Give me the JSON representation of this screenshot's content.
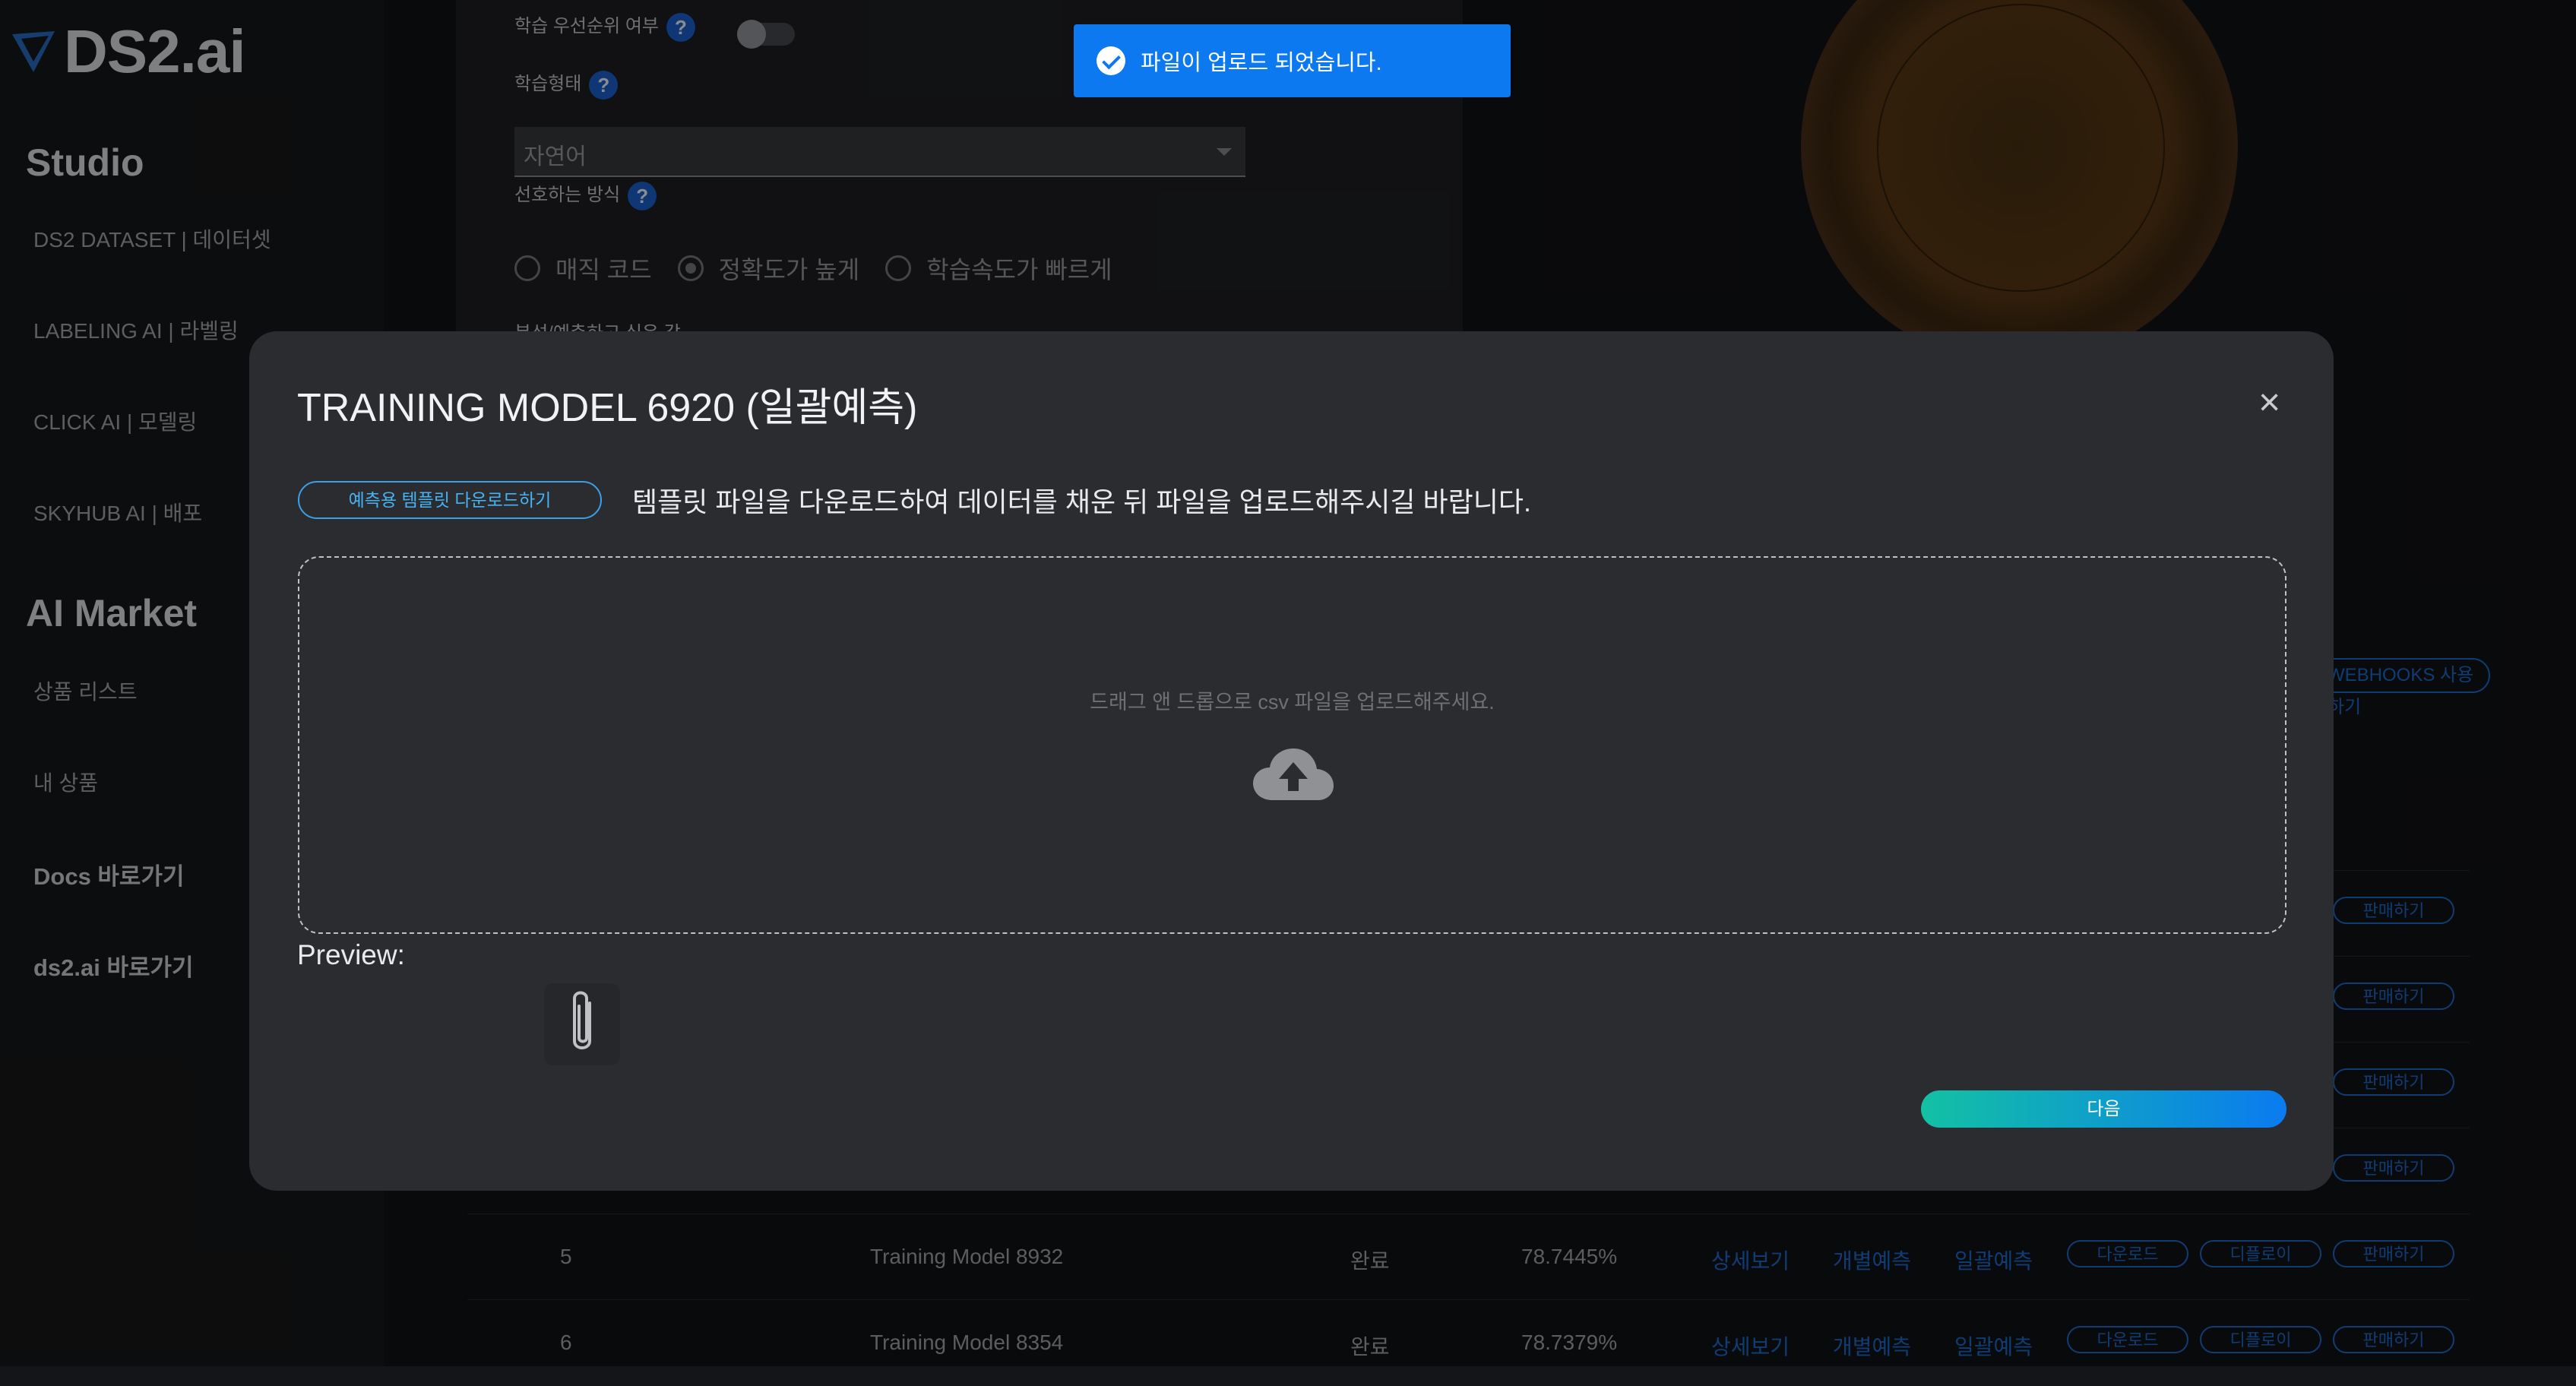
{
  "brand": {
    "name": "DS2.ai"
  },
  "sidebar": {
    "studio_heading": "Studio",
    "studio_items": [
      {
        "label": "DS2 DATASET | 데이터셋"
      },
      {
        "label": "LABELING AI | 라벨링"
      },
      {
        "label": "CLICK AI | 모델링"
      },
      {
        "label": "SKYHUB AI | 배포"
      }
    ],
    "market_heading": "AI Market",
    "market_items": [
      {
        "label": "상품 리스트"
      },
      {
        "label": "내 상품"
      }
    ],
    "docs_link": "Docs 바로가기",
    "site_link": "ds2.ai 바로가기"
  },
  "form": {
    "priority_label": "학습 우선순위 여부",
    "type_label": "학습형태",
    "type_value": "자연어",
    "pref_label": "선호하는 방식",
    "radio_options": [
      "매직 코드",
      "정확도가 높게",
      "학습속도가 빠르게"
    ],
    "radio_selected": "정확도가 높게",
    "predict_label_partial": "분석/예측하고 싶은 값",
    "help_glyph": "?"
  },
  "toast": {
    "message": "파일이 업로드 되었습니다."
  },
  "modal": {
    "title": "TRAINING MODEL 6920 (일괄예측)",
    "close_glyph": "×",
    "template_button": "예측용 템플릿 다운로드하기",
    "instruction": "템플릿 파일을 다운로드하여 데이터를 채운 뒤 파일을 업로드해주시길 바랍니다.",
    "drop_text": "드래그 앤 드롭으로 csv 파일을 업로드해주세요.",
    "preview_label": "Preview:",
    "next_button": "다음"
  },
  "background": {
    "hooks_button": "WEBHOOKS 사용하기",
    "sell_label": "판매하기",
    "rows": [
      {
        "no": "5",
        "name": "Training Model 8932",
        "status": "완료",
        "accuracy": "78.7445%",
        "detail": "상세보기",
        "single": "개별예측",
        "batch": "일괄예측",
        "download": "다운로드",
        "deploy": "디플로이",
        "sell": "판매하기"
      },
      {
        "no": "6",
        "name": "Training Model 8354",
        "status": "완료",
        "accuracy": "78.7379%",
        "detail": "상세보기",
        "single": "개별예측",
        "batch": "일괄예측",
        "download": "다운로드",
        "deploy": "디플로이",
        "sell": "판매하기"
      }
    ]
  },
  "colors": {
    "accent": "#0c79f0",
    "teal": "#13c1a4",
    "modal_bg": "#2b2c30"
  }
}
